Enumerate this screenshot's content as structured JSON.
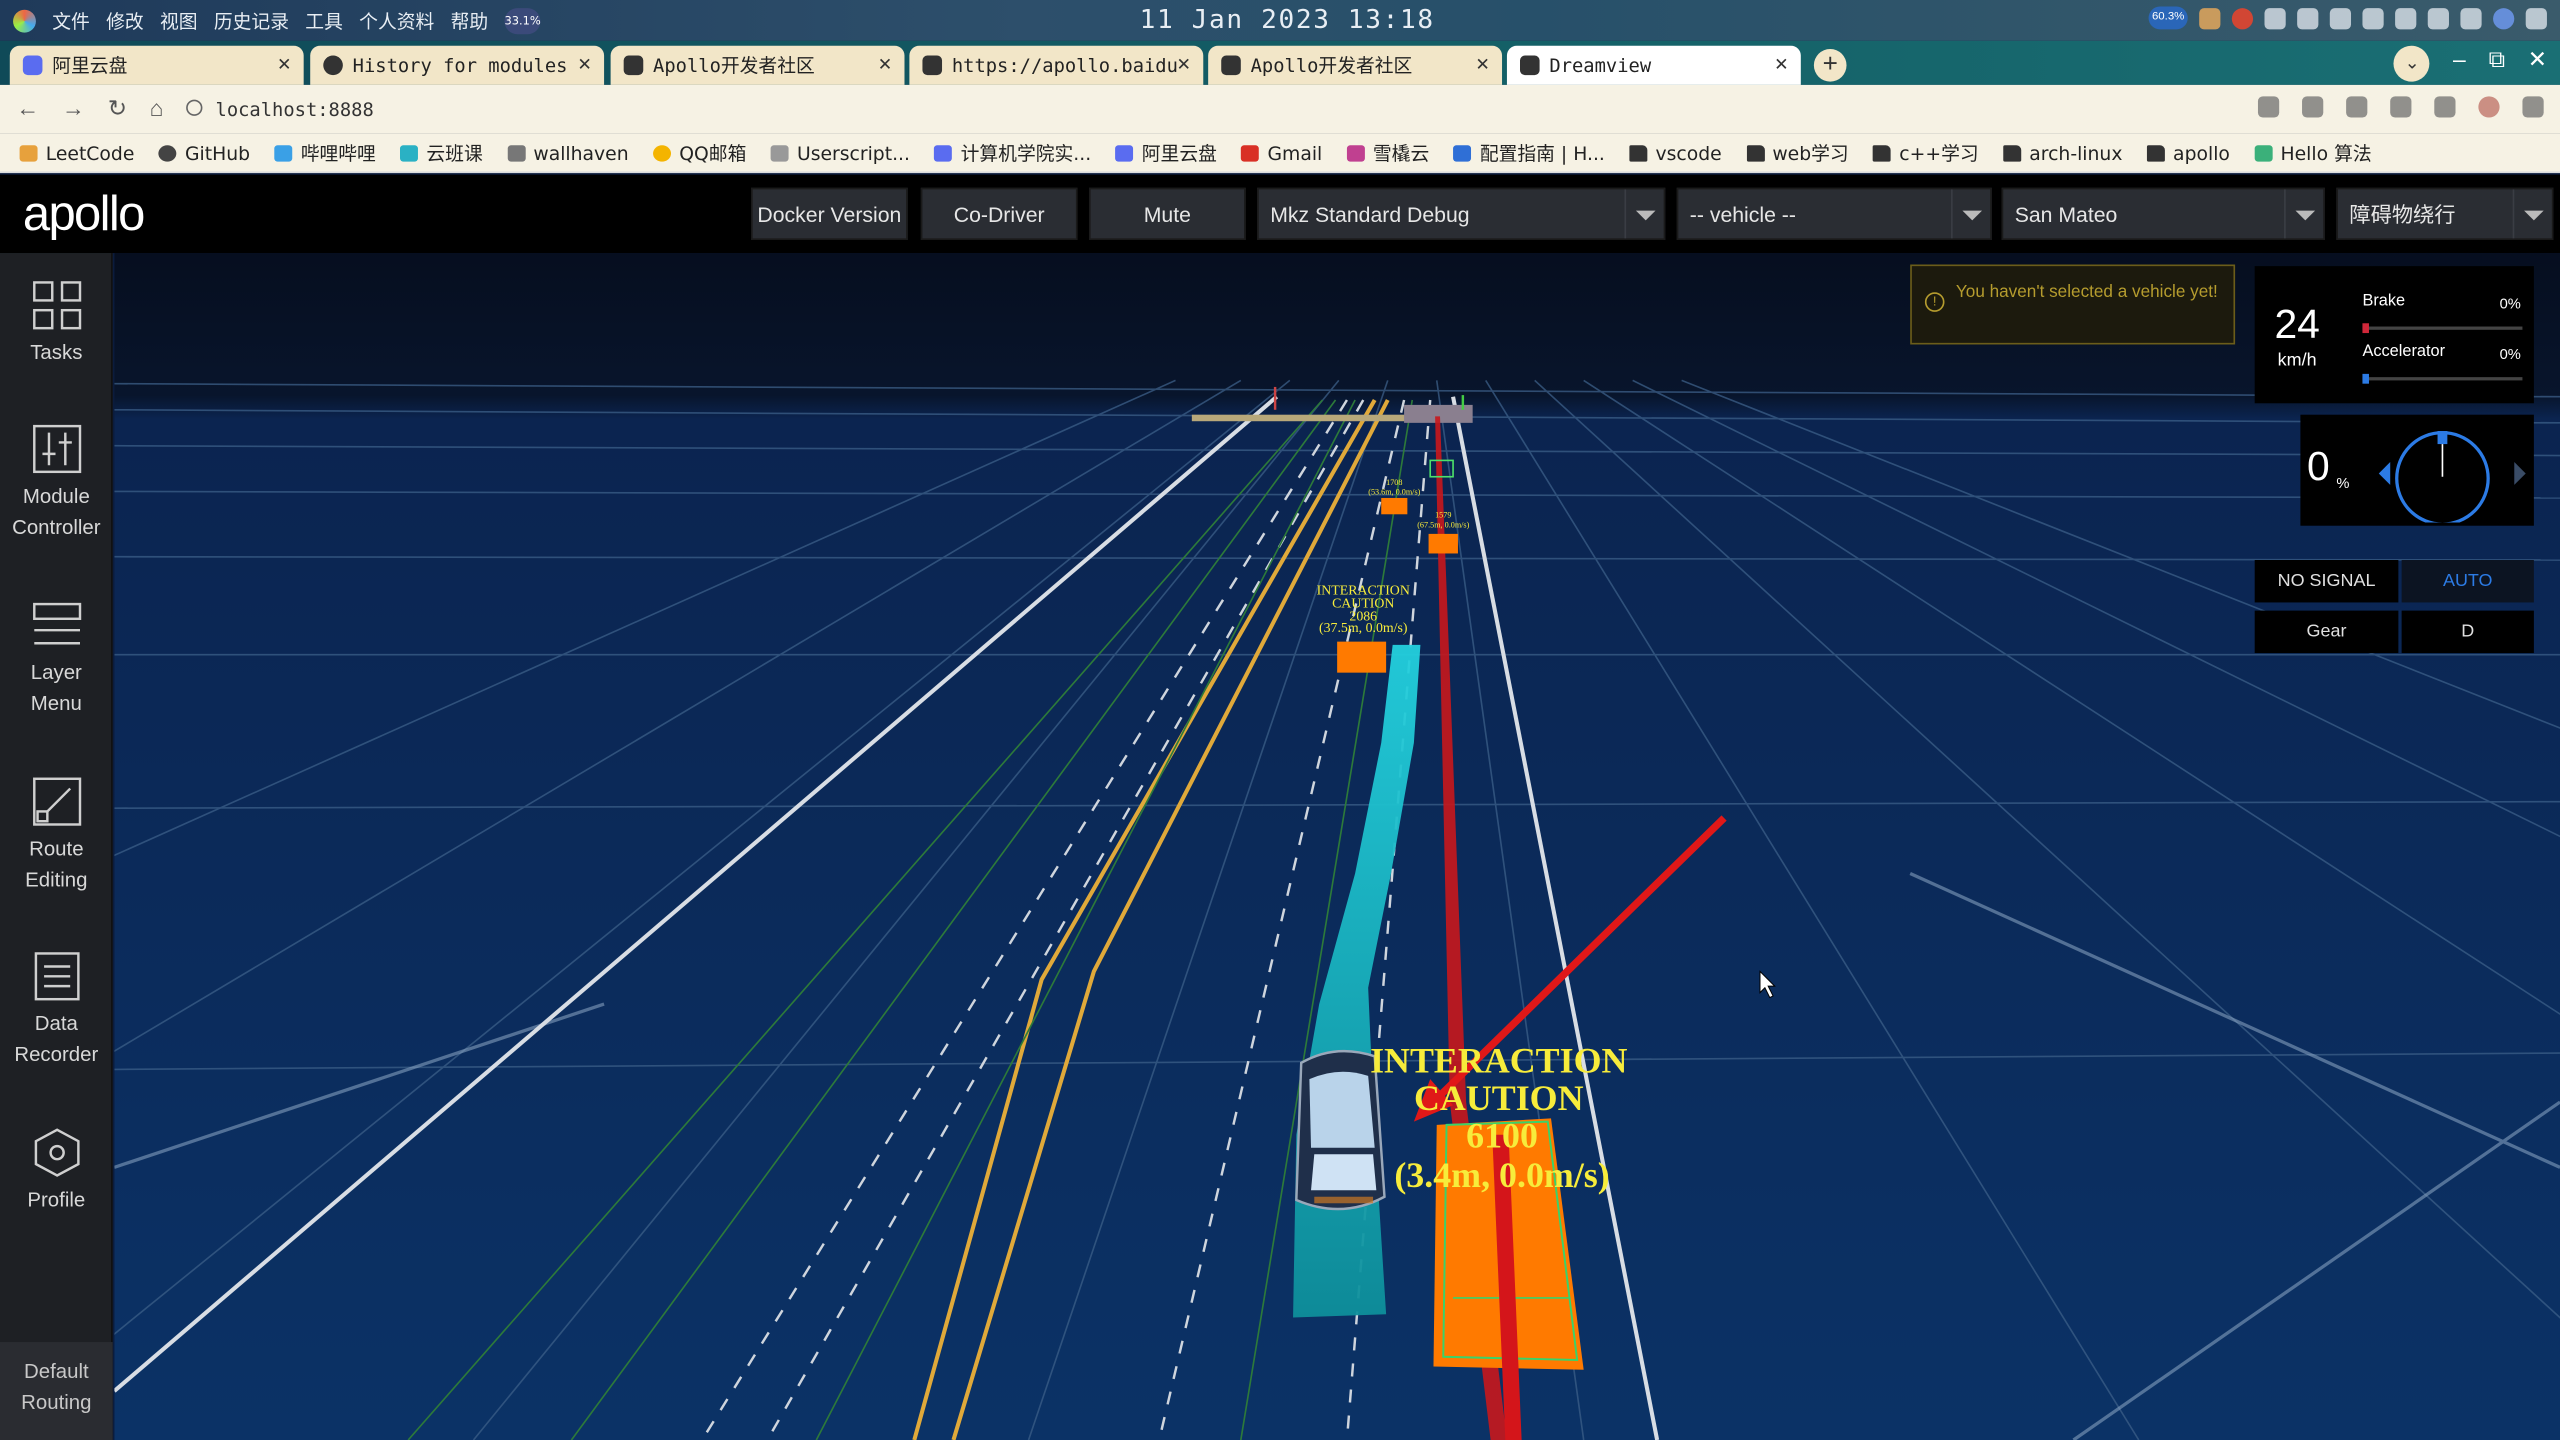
{
  "system_bar": {
    "menu": [
      "文件",
      "修改",
      "视图",
      "历史记录",
      "工具",
      "个人资料",
      "帮助"
    ],
    "cpu_left": "33.1%",
    "clock": "11 Jan 2023 13:18",
    "cpu_right": "60.3%"
  },
  "tabs": [
    {
      "title": "阿里云盘",
      "active": false
    },
    {
      "title": "History for modules",
      "active": false
    },
    {
      "title": "Apollo开发者社区",
      "active": false
    },
    {
      "title": "https://apollo.baidu",
      "active": false
    },
    {
      "title": "Apollo开发者社区",
      "active": false
    },
    {
      "title": "Dreamview",
      "active": true
    }
  ],
  "address": {
    "url": "localhost:8888"
  },
  "bookmarks": [
    "LeetCode",
    "GitHub",
    "哔哩哔哩",
    "云班课",
    "wallhaven",
    "QQ邮箱",
    "Userscript...",
    "计算机学院实...",
    "阿里云盘",
    "Gmail",
    "雪橇云",
    "配置指南 | H...",
    "vscode",
    "web学习",
    "c++学习",
    "arch-linux",
    "apollo",
    "Hello 算法"
  ],
  "header": {
    "logo_text": "apollo",
    "buttons": {
      "docker": "Docker Version",
      "codriver": "Co-Driver",
      "mute": "Mute"
    },
    "mode_select": "Mkz Standard Debug",
    "vehicle_select": "-- vehicle --",
    "map_select": "San Mateo",
    "scenario_select": "障碍物绕行"
  },
  "sidebar": {
    "items": [
      {
        "label1": "Tasks",
        "label2": ""
      },
      {
        "label1": "Module",
        "label2": "Controller"
      },
      {
        "label1": "Layer",
        "label2": "Menu"
      },
      {
        "label1": "Route",
        "label2": "Editing"
      },
      {
        "label1": "Data",
        "label2": "Recorder"
      },
      {
        "label1": "Profile",
        "label2": ""
      }
    ],
    "default_routing": [
      "Default",
      "Routing"
    ]
  },
  "warning": {
    "text": "You haven't selected a vehicle yet!"
  },
  "dashboard": {
    "speed": "24",
    "speed_unit": "km/h",
    "brake_label": "Brake",
    "brake_value": "0%",
    "brake_level": 0,
    "accel_label": "Accelerator",
    "accel_value": "0%",
    "accel_level": 0,
    "steering_value": "0",
    "steering_unit": "%",
    "signal": "NO SIGNAL",
    "drive_mode": "AUTO",
    "gear_label": "Gear",
    "gear_value": "D"
  },
  "scene": {
    "near_label": [
      "INTERACTION",
      "CAUTION",
      "6100",
      "(3.4m, 0.0m/s)"
    ],
    "mid_label": [
      "INTERACTION",
      "CAUTION",
      "2086",
      "(37.5m, 0.0m/s)"
    ],
    "far_label_1": [
      "1708",
      "(53.6m, 0.0m/s)"
    ],
    "far_label_2": [
      "1579",
      "(67.5m, 0.0m/s)"
    ]
  },
  "colors": {
    "scene_bg": "#0b2a55",
    "grid": "#4a6a8e",
    "lane_yellow": "#e0a93a",
    "lane_white": "#d8dde4",
    "path_teal": "#16b4c2",
    "obstacle": "#ff7a00",
    "annotation": "#f7ec3b",
    "arrow_red": "#e01818",
    "auto_blue": "#2c7be5"
  }
}
